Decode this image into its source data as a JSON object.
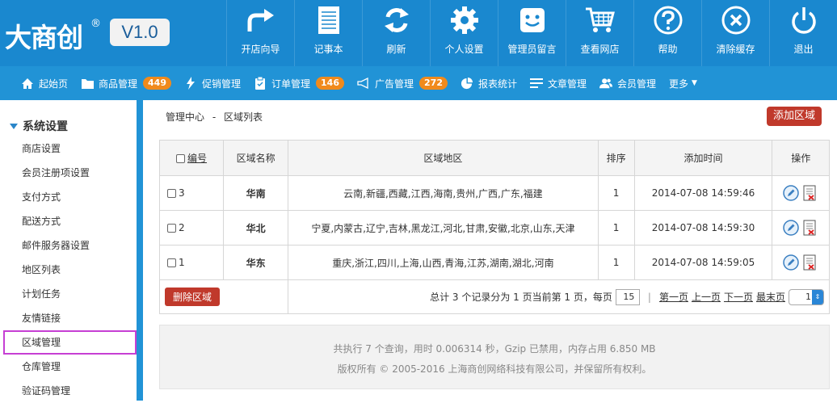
{
  "logo": {
    "brand": "大商创",
    "reg": "®",
    "version": "V1.0"
  },
  "toolbar": [
    {
      "label": "开店向导",
      "icon": "arrow-turn-icon"
    },
    {
      "label": "记事本",
      "icon": "notepad-icon"
    },
    {
      "label": "刷新",
      "icon": "refresh-icon"
    },
    {
      "label": "个人设置",
      "icon": "gear-icon"
    },
    {
      "label": "管理员留言",
      "icon": "message-icon"
    },
    {
      "label": "查看网店",
      "icon": "cart-icon"
    },
    {
      "label": "帮助",
      "icon": "help-icon"
    },
    {
      "label": "清除缓存",
      "icon": "clear-cache-icon"
    },
    {
      "label": "退出",
      "icon": "power-icon"
    }
  ],
  "nav": {
    "home": "起始页",
    "goods": "商品管理",
    "goods_count": "449",
    "promo": "促销管理",
    "orders": "订单管理",
    "orders_count": "146",
    "ads": "广告管理",
    "ads_count": "272",
    "reports": "报表统计",
    "articles": "文章管理",
    "members": "会员管理",
    "more": "更多"
  },
  "sidebar": {
    "group": "系统设置",
    "items": [
      {
        "label": "商店设置"
      },
      {
        "label": "会员注册项设置"
      },
      {
        "label": "支付方式"
      },
      {
        "label": "配送方式"
      },
      {
        "label": "邮件服务器设置"
      },
      {
        "label": "地区列表"
      },
      {
        "label": "计划任务"
      },
      {
        "label": "友情链接"
      },
      {
        "label": "区域管理"
      },
      {
        "label": "仓库管理"
      },
      {
        "label": "验证码管理"
      }
    ]
  },
  "breadcrumb": {
    "root": "管理中心",
    "sep": "-",
    "current": "区域列表"
  },
  "add_button": "添加区域",
  "table": {
    "headers": {
      "id": "编号",
      "name": "区域名称",
      "regions": "区域地区",
      "sort": "排序",
      "time": "添加时间",
      "ops": "操作"
    },
    "rows": [
      {
        "id": "3",
        "name": "华南",
        "regions": "云南,新疆,西藏,江西,海南,贵州,广西,广东,福建",
        "sort": "1",
        "time": "2014-07-08 14:59:46"
      },
      {
        "id": "2",
        "name": "华北",
        "regions": "宁夏,内蒙古,辽宁,吉林,黑龙江,河北,甘肃,安徽,北京,山东,天津",
        "sort": "1",
        "time": "2014-07-08 14:59:30"
      },
      {
        "id": "1",
        "name": "华东",
        "regions": "重庆,浙江,四川,上海,山西,青海,江苏,湖南,湖北,河南",
        "sort": "1",
        "time": "2014-07-08 14:59:05"
      }
    ]
  },
  "delete_button": "删除区域",
  "pager": {
    "summary": "总计 3 个记录分为 1 页当前第 1 页，每页",
    "per_page": "15",
    "first": "第一页",
    "prev": "上一页",
    "next": "下一页",
    "last": "最末页",
    "page_select": "1"
  },
  "footer": {
    "line1": "共执行 7 个查询，用时 0.006314 秒，Gzip 已禁用，内存占用 6.850 MB",
    "line2": "版权所有 © 2005-2016 上海商创网络科技有限公司，并保留所有权利。"
  }
}
